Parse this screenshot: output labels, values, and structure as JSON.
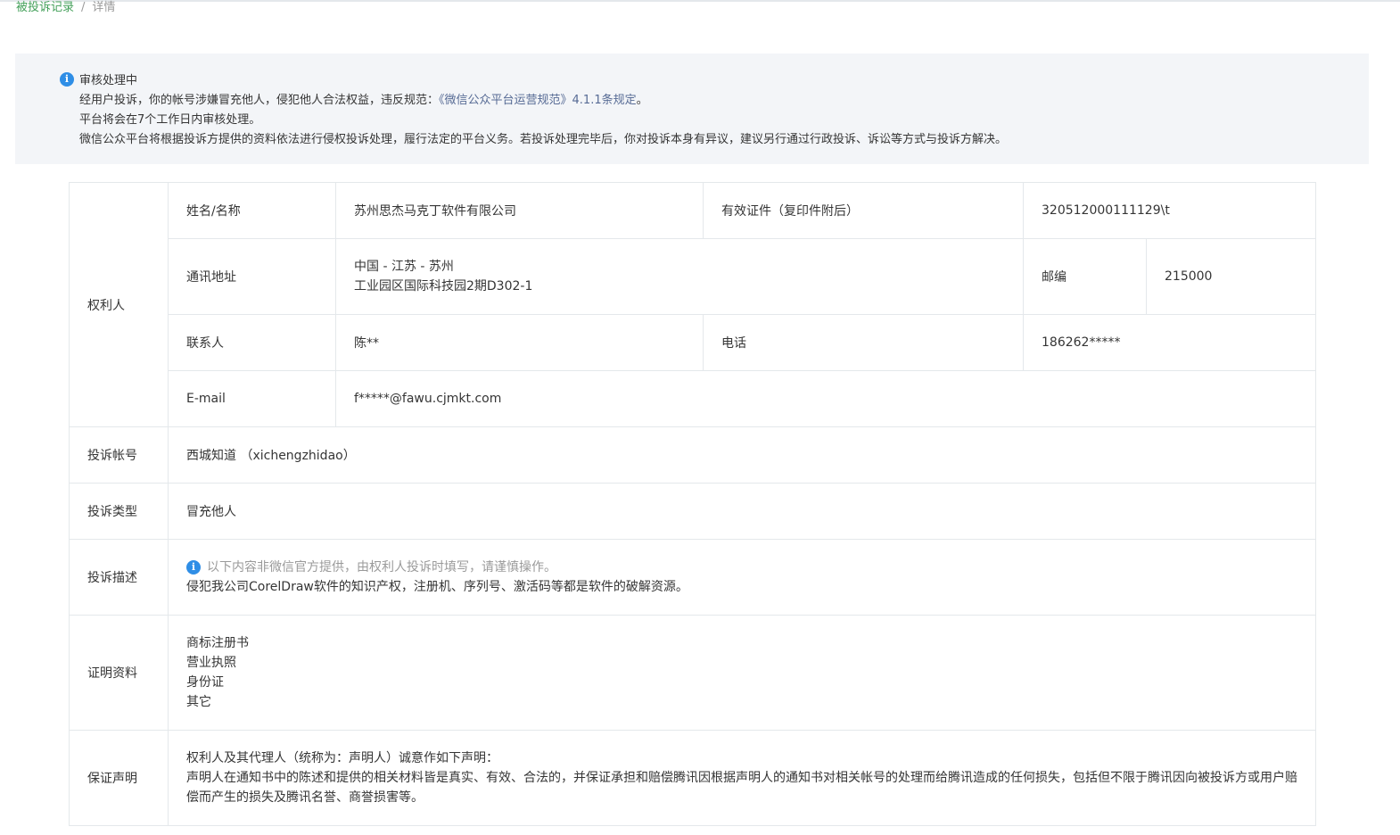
{
  "breadcrumb": {
    "parent": "被投诉记录",
    "separator": "/",
    "current": "详情"
  },
  "notice": {
    "icon": "info-icon",
    "status": "审核处理中",
    "line1_prefix": "经用户投诉，你的帐号涉嫌冒充他人，侵犯他人合法权益，违反规范：",
    "line1_link": "《微信公众平台运营规范》4.1.1条规定",
    "line1_suffix": "。",
    "line2": "平台将会在7个工作日内审核处理。",
    "line3": "微信公众平台将根据投诉方提供的资料依法进行侵权投诉处理，履行法定的平台义务。若投诉处理完毕后，你对投诉本身有异议，建议另行通过行政投诉、诉讼等方式与投诉方解决。",
    "colors": {
      "background": "#f3f5f8",
      "icon": "#2f8ee6",
      "link": "#576b95"
    }
  },
  "rights_holder": {
    "label": "权利人",
    "name_label": "姓名/名称",
    "name_value": "苏州思杰马克丁软件有限公司",
    "id_label": "有效证件（复印件附后）",
    "id_value": "320512000111129\\t",
    "address_label": "通讯地址",
    "address_line1": "中国 - 江苏 - 苏州",
    "address_line2": "工业园区国际科技园2期D302-1",
    "postcode_label": "邮编",
    "postcode_value": "215000",
    "contact_label": "联系人",
    "contact_value": "陈**",
    "phone_label": "电话",
    "phone_value": "186262*****",
    "email_label": "E-mail",
    "email_value": "f*****@fawu.cjmkt.com"
  },
  "complaint_account": {
    "label": "投诉帐号",
    "value": "西城知道 （xichengzhidao）"
  },
  "complaint_type": {
    "label": "投诉类型",
    "value": "冒充他人"
  },
  "complaint_desc": {
    "label": "投诉描述",
    "note": "以下内容非微信官方提供，由权利人投诉时填写，请谨慎操作。",
    "text": "侵犯我公司CorelDraw软件的知识产权，注册机、序列号、激活码等都是软件的破解资源。"
  },
  "evidence": {
    "label": "证明资料",
    "items": [
      "商标注册书",
      "营业执照",
      "身份证",
      "其它"
    ]
  },
  "declaration": {
    "label": "保证声明",
    "line1": "权利人及其代理人（统称为：声明人）诚意作如下声明：",
    "line2": "声明人在通知书中的陈述和提供的相关材料皆是真实、有效、合法的，并保证承担和赔偿腾讯因根据声明人的通知书对相关帐号的处理而给腾讯造成的任何损失，包括但不限于腾讯因向被投诉方或用户赔偿而产生的损失及腾讯名誉、商誉损害等。"
  },
  "colors": {
    "breadcrumb_link": "#44a05a",
    "border": "#e4e8eb",
    "muted_text": "#9a9a9a"
  }
}
